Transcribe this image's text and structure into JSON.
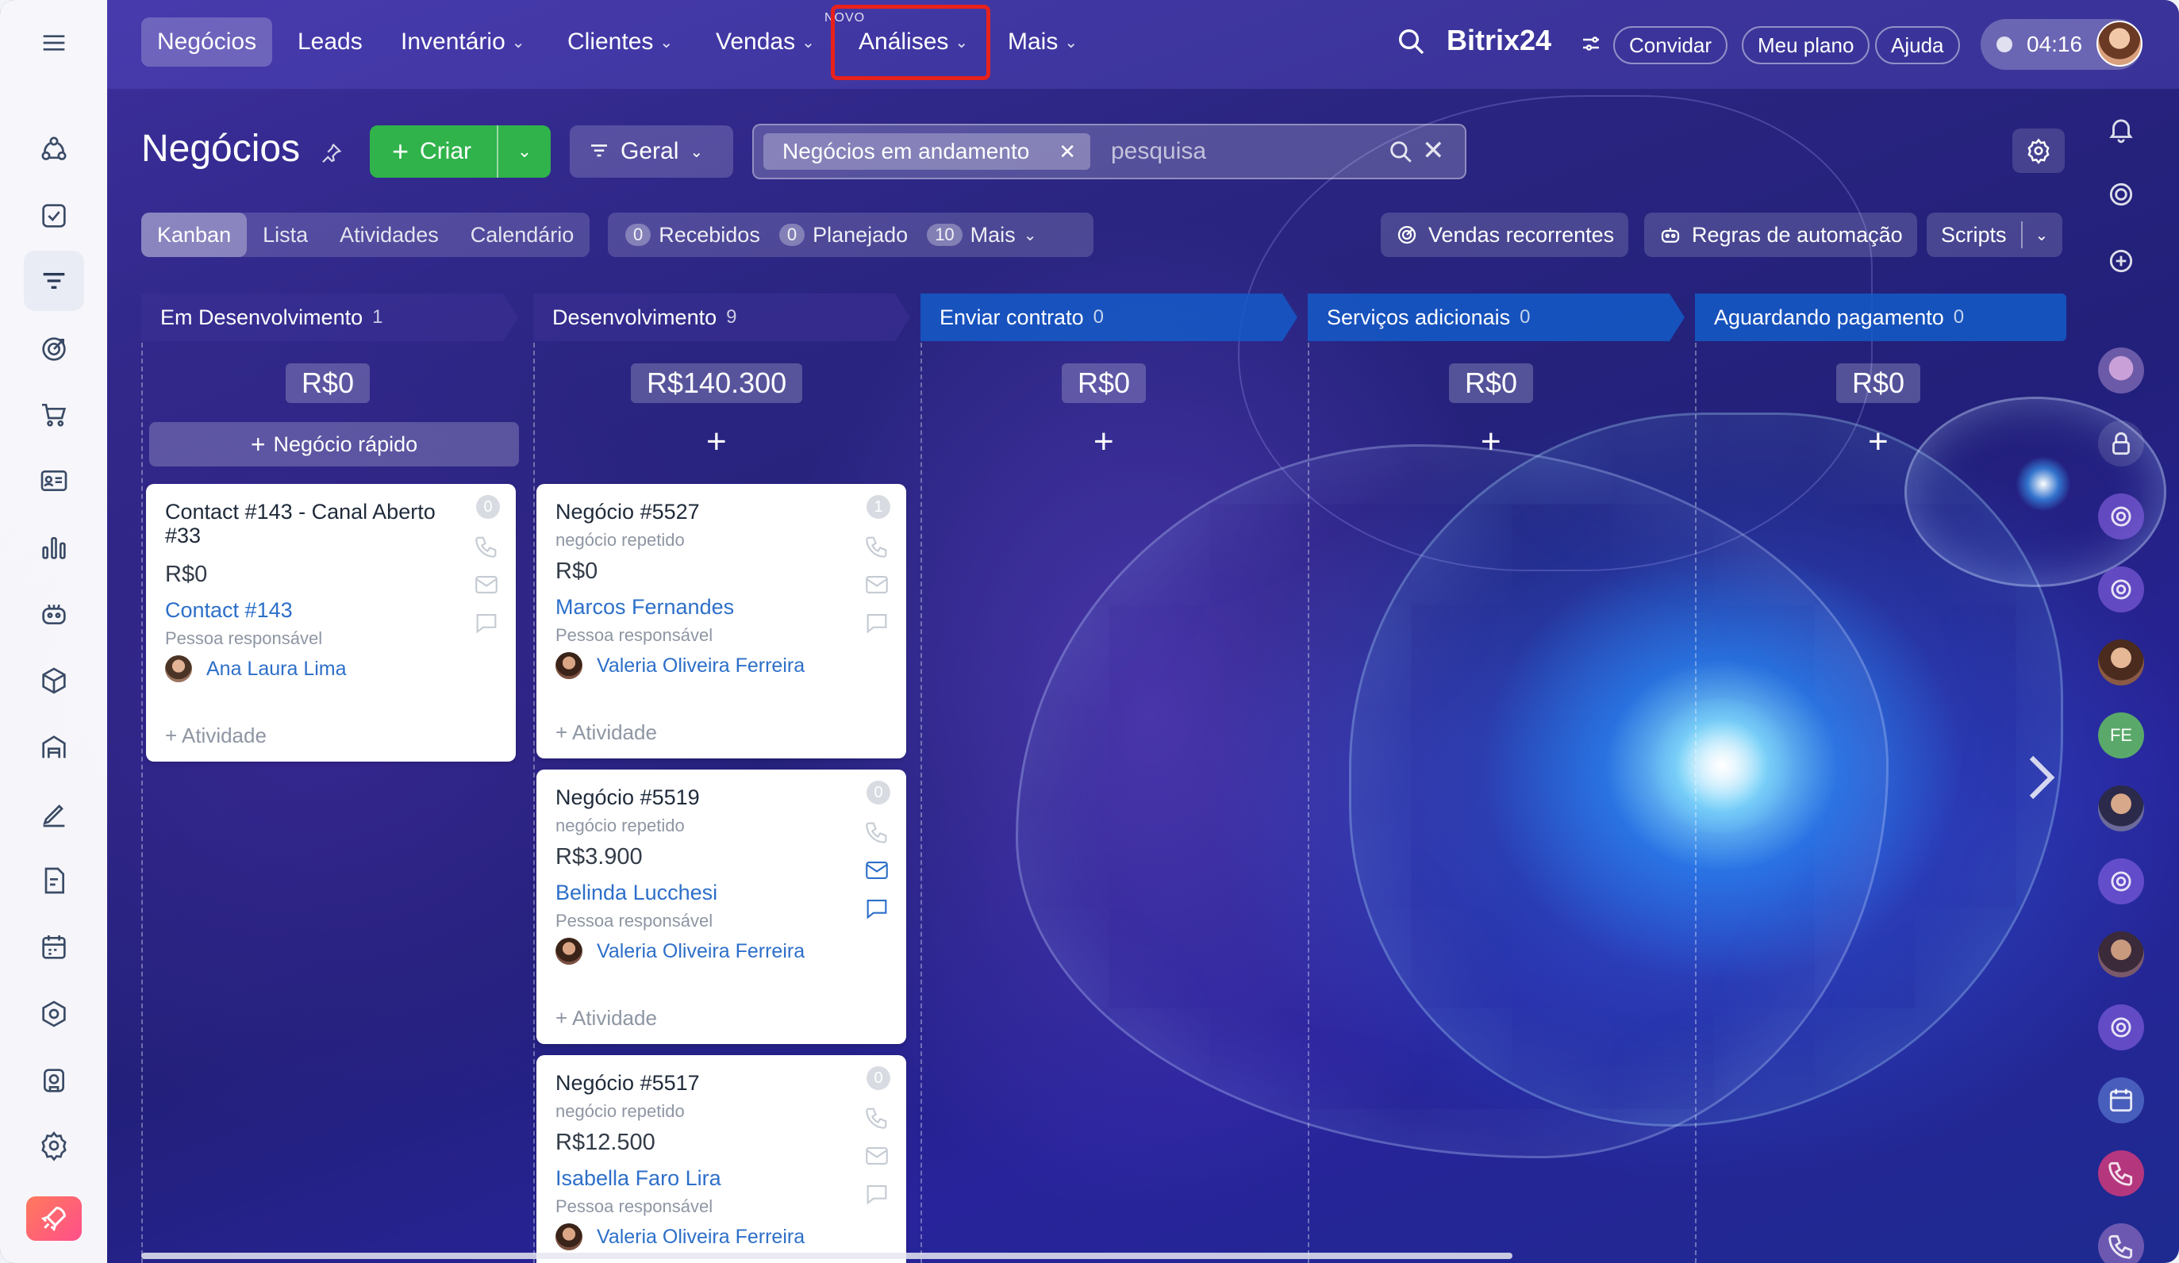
{
  "topnav": {
    "items": [
      {
        "label": "Negócios",
        "has_menu": false
      },
      {
        "label": "Leads",
        "has_menu": false
      },
      {
        "label": "Inventário",
        "has_menu": true
      },
      {
        "label": "Clientes",
        "has_menu": true
      },
      {
        "label": "Vendas",
        "has_menu": true,
        "badge": "NOVO"
      },
      {
        "label": "Análises",
        "has_menu": true,
        "highlighted": true
      },
      {
        "label": "Mais",
        "has_menu": true
      }
    ],
    "brand": "Bitrix24",
    "invite": "Convidar",
    "my_plan": "Meu plano",
    "help": "Ajuda",
    "time": "04:16"
  },
  "header": {
    "title": "Negócios",
    "create_label": "Criar",
    "category_label": "Geral",
    "filter_chip": "Negócios em andamento",
    "search_placeholder": "pesquisa"
  },
  "views": {
    "tabs": [
      "Kanban",
      "Lista",
      "Atividades",
      "Calendário"
    ],
    "active": "Kanban",
    "counters": [
      {
        "count": "0",
        "label": "Recebidos"
      },
      {
        "count": "0",
        "label": "Planejado"
      },
      {
        "count": "10",
        "label": "Mais"
      }
    ],
    "recurring": "Vendas recorrentes",
    "automation": "Regras de automação",
    "scripts": "Scripts"
  },
  "columns": [
    {
      "title": "Em Desenvolvimento",
      "count": "1",
      "sum": "R$0",
      "color": "#3c3296"
    },
    {
      "title": "Desenvolvimento",
      "count": "9",
      "sum": "R$140.300",
      "color": "#3c3296"
    },
    {
      "title": "Enviar contrato",
      "count": "0",
      "sum": "R$0",
      "color": "#145ac8"
    },
    {
      "title": "Serviços adicionais",
      "count": "0",
      "sum": "R$0",
      "color": "#145ac8"
    },
    {
      "title": "Aguardando pagamento",
      "count": "0",
      "sum": "R$0",
      "color": "#145ac8"
    }
  ],
  "quick_deal": "Negócio rápido",
  "cards": [
    {
      "title": "Contact #143 - Canal Aberto #33",
      "subtitle": "",
      "amount": "R$0",
      "contact": "Contact #143",
      "resp_label": "Pessoa responsável",
      "responsible": "Ana Laura Lima",
      "activity": "+ Atividade",
      "badge": "0"
    },
    {
      "title": "Negócio #5527",
      "subtitle": "negócio repetido",
      "amount": "R$0",
      "contact": "Marcos Fernandes",
      "resp_label": "Pessoa responsável",
      "responsible": "Valeria Oliveira Ferreira",
      "activity": "+ Atividade",
      "badge": "1"
    },
    {
      "title": "Negócio #5519",
      "subtitle": "negócio repetido",
      "amount": "R$3.900",
      "contact": "Belinda Lucchesi",
      "resp_label": "Pessoa responsável",
      "responsible": "Valeria Oliveira Ferreira",
      "activity": "+ Atividade",
      "badge": "0"
    },
    {
      "title": "Negócio #5517",
      "subtitle": "negócio repetido",
      "amount": "R$12.500",
      "contact": "Isabella Faro Lira",
      "resp_label": "Pessoa responsável",
      "responsible": "Valeria Oliveira Ferreira",
      "activity": "",
      "badge": "0"
    }
  ],
  "rail": {
    "initials": "FE"
  },
  "colors": {
    "create": "#2fb34a",
    "link": "#2d6fc9",
    "highlight": "#e8211c",
    "stage_blue": "#145ac8"
  }
}
